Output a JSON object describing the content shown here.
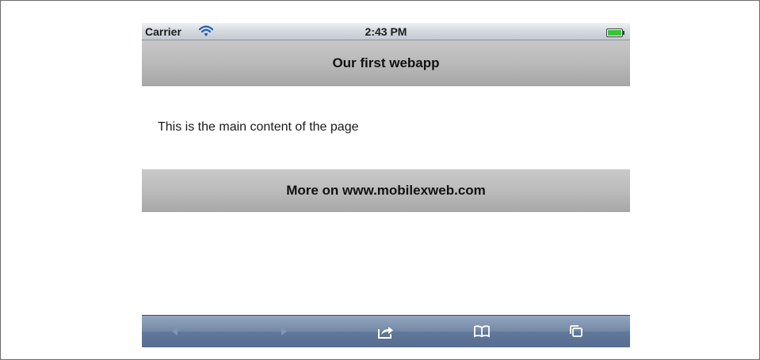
{
  "status_bar": {
    "carrier": "Carrier",
    "time": "2:43 PM",
    "wifi_icon": "wifi-icon",
    "battery_icon": "battery-icon",
    "battery_color": "#3cc93c"
  },
  "header": {
    "title": "Our first webapp"
  },
  "main": {
    "content": "This is the main content of the page"
  },
  "footer": {
    "link_text": "More on www.mobilexweb.com"
  },
  "toolbar": {
    "buttons": [
      {
        "icon": "back-arrow-icon",
        "enabled": false
      },
      {
        "icon": "forward-arrow-icon",
        "enabled": false
      },
      {
        "icon": "share-icon",
        "enabled": true
      },
      {
        "icon": "bookmarks-icon",
        "enabled": true
      },
      {
        "icon": "pages-icon",
        "enabled": true
      }
    ]
  },
  "colors": {
    "toolbar": "#6a7f9f",
    "header_bar": "#b9b9b9"
  }
}
